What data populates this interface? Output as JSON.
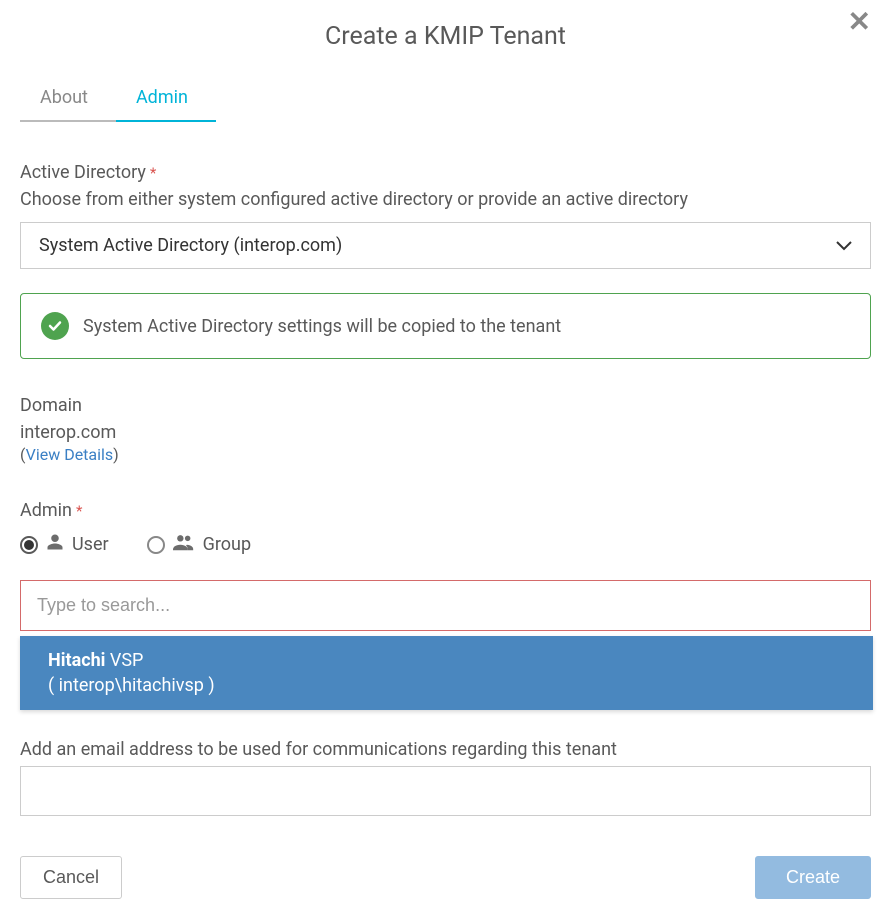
{
  "dialog": {
    "title": "Create a KMIP Tenant"
  },
  "tabs": {
    "about": "About",
    "admin": "Admin"
  },
  "activeDirectory": {
    "label": "Active Directory",
    "helper": "Choose from either system configured active directory or provide an active directory",
    "selected": "System Active Directory (interop.com)",
    "banner": "System Active Directory settings will be copied to the tenant"
  },
  "domain": {
    "label": "Domain",
    "value": "interop.com",
    "viewDetails": "View Details"
  },
  "admin": {
    "label": "Admin",
    "radioUser": "User",
    "radioGroup": "Group",
    "searchPlaceholder": "Type to search...",
    "suggestion": {
      "namePrefix": "Hitachi",
      "nameRest": " VSP",
      "path": "( interop\\hitachivsp )"
    }
  },
  "email": {
    "helper": "Add an email address to be used for communications regarding this tenant"
  },
  "footer": {
    "cancel": "Cancel",
    "create": "Create"
  }
}
